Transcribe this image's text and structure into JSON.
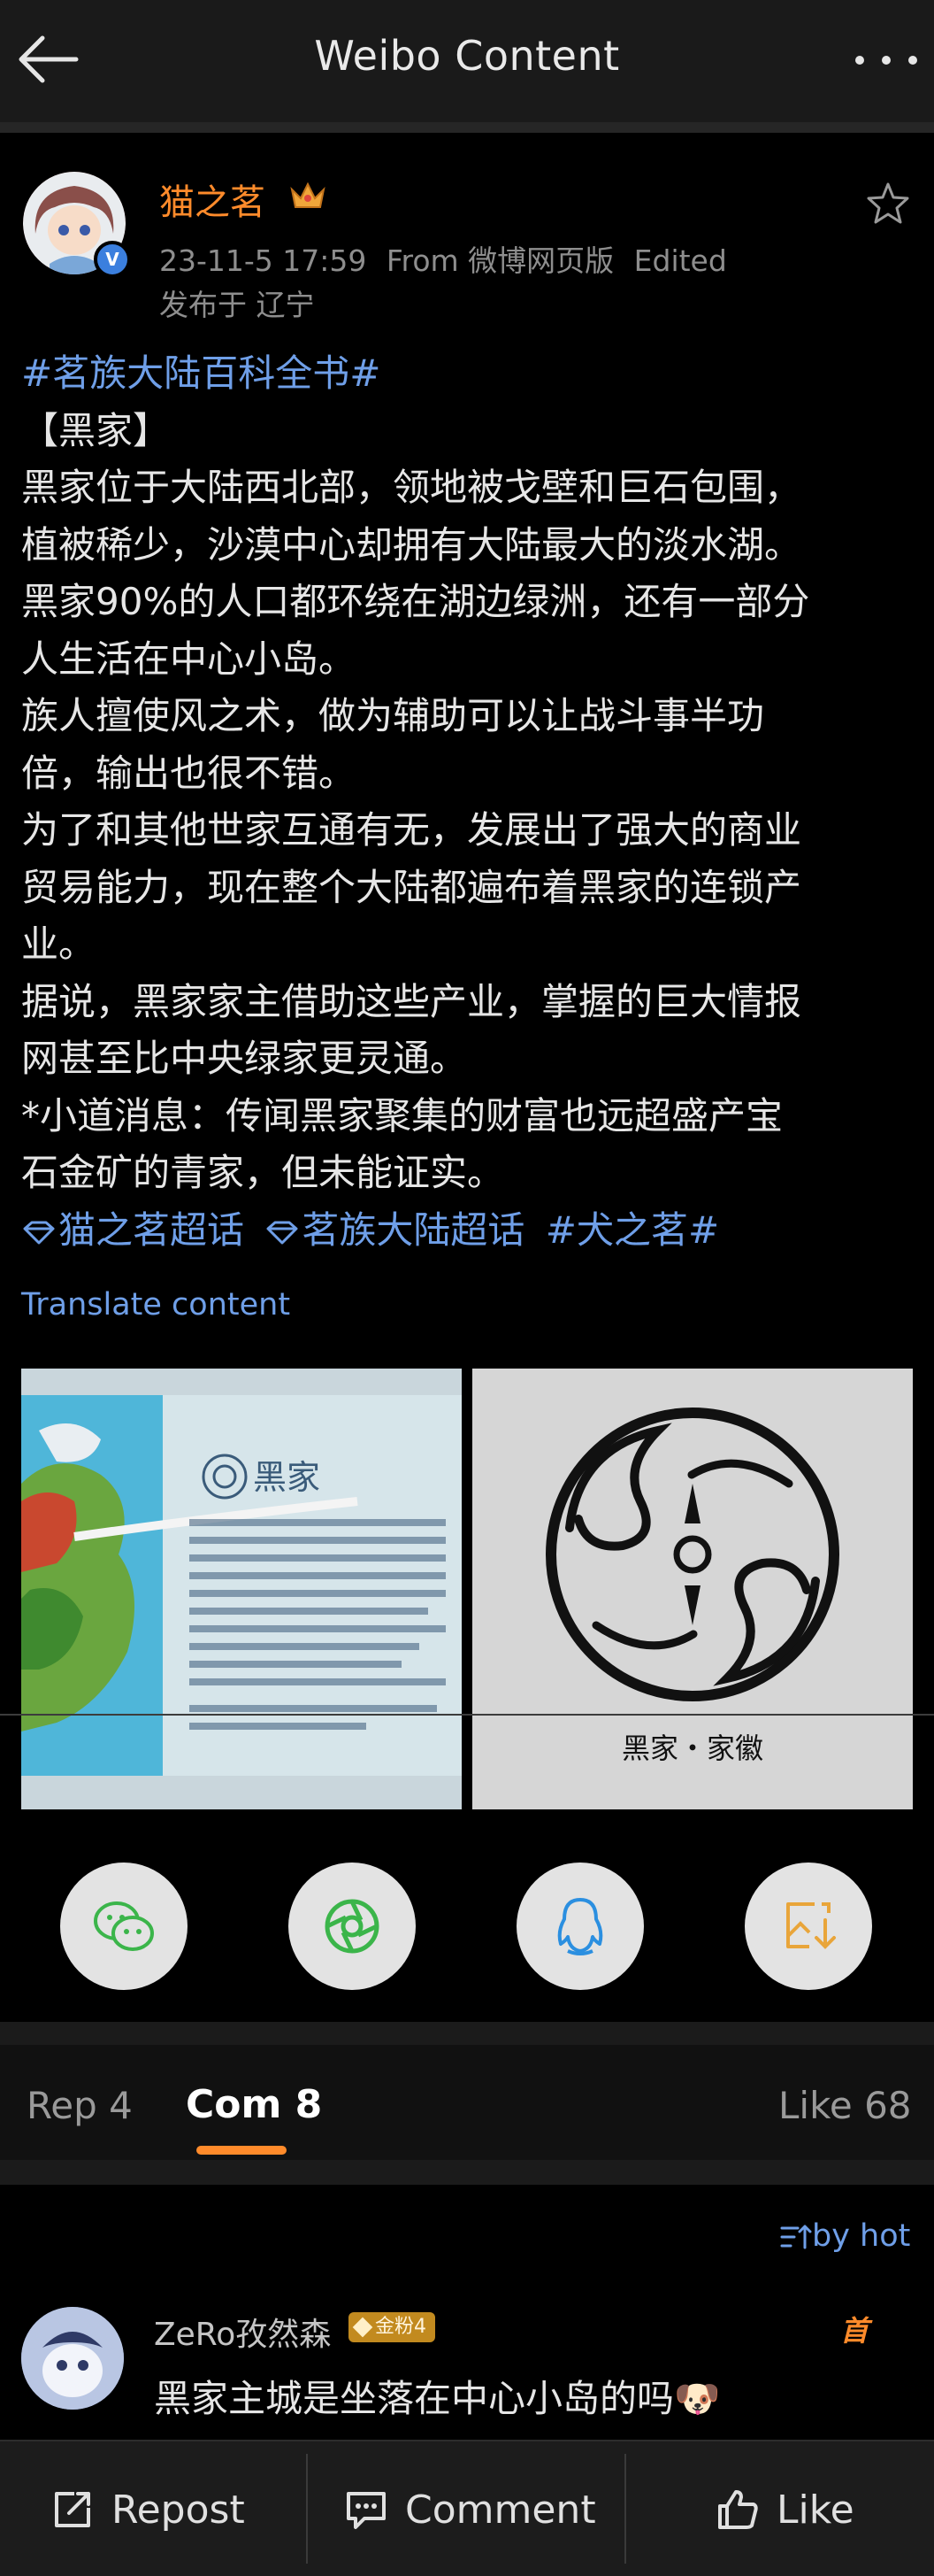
{
  "header": {
    "title": "Weibo Content"
  },
  "post": {
    "username": "猫之茗",
    "time": "23-11-5 17:59",
    "source": "From 微博网页版",
    "edited": "Edited",
    "location": "发布于 辽宁",
    "lines": [
      "#茗族大陆百科全书#",
      "【黑家】",
      "黑家位于大陆西北部，领地被戈壁和巨石包围，",
      "植被稀少，沙漠中心却拥有大陆最大的淡水湖。",
      "黑家90%的人口都环绕在湖边绿洲，还有一部分",
      "人生活在中心小岛。",
      "族人擅使风之术，做为辅助可以让战斗事半功",
      "倍，输出也很不错。",
      "为了和其他世家互通有无，发展出了强大的商业",
      "贸易能力，现在整个大陆都遍布着黑家的连锁产",
      "业。",
      "据说，黑家家主借助这些产业，掌握的巨大情报",
      "网甚至比中央绿家更灵通。",
      "*小道消息：传闻黑家聚集的财富也远超盛产宝",
      "石金矿的青家，但未能证实。"
    ],
    "tags": {
      "chaohua1": "猫之茗超话",
      "chaohua2": "茗族大陆超话",
      "topic2": "#犬之茗#"
    },
    "translate": "Translate content",
    "images": {
      "left_title": "黑家",
      "right_caption": "黑家・家徽"
    }
  },
  "tabs": {
    "repost": "Rep 4",
    "comments": "Com 8",
    "likes": "Like 68"
  },
  "sort": "by hot",
  "comment": {
    "username": "ZeRo孜然森",
    "badge": "金粉4",
    "tag": "首",
    "text": "黑家主城是坐落在中心小岛的吗🐶"
  },
  "bottom": {
    "repost": "Repost",
    "comment": "Comment",
    "like": "Like"
  },
  "colors": {
    "accent": "#ff8b2b",
    "link": "#6f9fe8",
    "background": "#000000"
  }
}
